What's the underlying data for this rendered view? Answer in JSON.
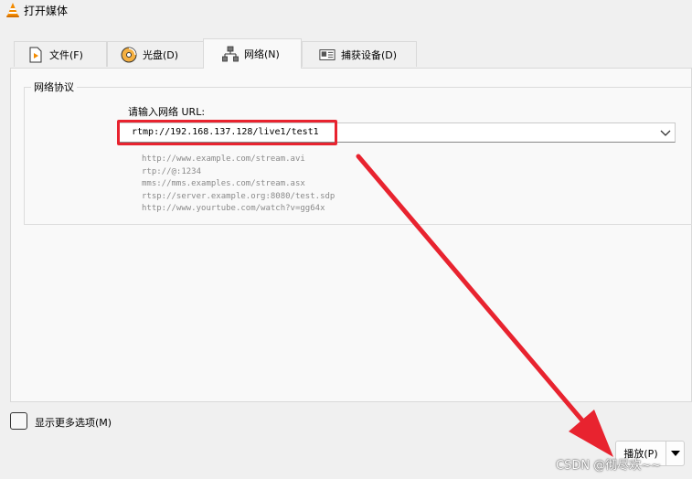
{
  "window": {
    "title": "打开媒体"
  },
  "tabs": [
    {
      "label": "文件(F)",
      "icon": "file-play-icon"
    },
    {
      "label": "光盘(D)",
      "icon": "disc-icon"
    },
    {
      "label": "网络(N)",
      "icon": "network-icon",
      "active": true
    },
    {
      "label": "捕获设备(D)",
      "icon": "capture-card-icon"
    }
  ],
  "network": {
    "group_title": "网络协议",
    "url_label": "请输入网络 URL:",
    "url_value": "rtmp://192.168.137.128/live1/test1",
    "examples": [
      "http://www.example.com/stream.avi",
      "rtp://@:1234",
      "mms://mms.examples.com/stream.asx",
      "rtsp://server.example.org:8080/test.sdp",
      "http://www.yourtube.com/watch?v=gg64x"
    ]
  },
  "options": {
    "more_options_label": "显示更多选项(M)",
    "checked": false
  },
  "footer": {
    "play_label": "播放(P)",
    "watermark": "CSDN @彻尽欢~~"
  },
  "colors": {
    "annotation_red": "#e8232f",
    "panel": "#f9f9f9",
    "background": "#f0f0f0"
  }
}
